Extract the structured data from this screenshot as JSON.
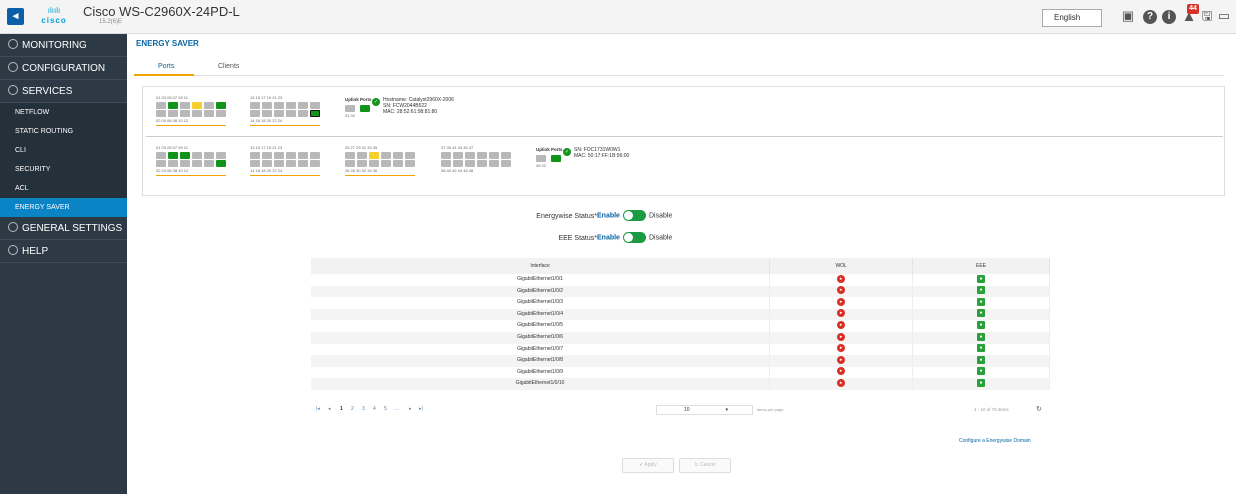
{
  "header": {
    "brand": "cisco",
    "device": "Cisco WS-C2960X-24PD-L",
    "version": "15.2(6)E",
    "language": "English",
    "alert_count": "44",
    "icons": [
      "save-config-icon",
      "help-icon",
      "info-icon",
      "alert-icon",
      "save-icon",
      "monitor-icon"
    ]
  },
  "sidebar": {
    "monitoring": "MONITORING",
    "configuration": "CONFIGURATION",
    "services": "SERVICES",
    "services_items": [
      "NETFLOW",
      "STATIC ROUTING",
      "CLI",
      "SECURITY",
      "ACL",
      "ENERGY SAVER"
    ],
    "general_settings": "GENERAL SETTINGS",
    "help": "HELP"
  },
  "page": {
    "title": "ENERGY SAVER",
    "tabs": [
      "Ports",
      "Clients"
    ]
  },
  "switch1": {
    "port_odd": "01 03 05 07 09 11",
    "port_even": "02 04 06 08 10 12",
    "port_odd2": "13 15 17 19 21 23",
    "port_even2": "14 16 18 20 22 24",
    "uplink_title": "Uplink Ports",
    "uplink_nums": "01   02",
    "hostname": "Hostname: Catalyst2960X-2006",
    "sn": "SN: FCW2044B522",
    "mac": "MAC: 28:52:61:98:81:80"
  },
  "switch2": {
    "port_odd": "01 03 05 07 09 11",
    "port_even": "02 04 06 08 10 12",
    "port_odd2": "13 15 17 19 21 23",
    "port_even2": "14 16 18 20 22 24",
    "port_odd3": "25 27 29 31 33 35",
    "port_even3": "26 28 30 32 34 36",
    "port_odd4": "37 39 41 43 45 47",
    "port_even4": "38 40 42 44 46 48",
    "uplink_title": "Uplink Ports",
    "uplink_nums": "49   02",
    "sn": "SN: FOC1731W0W1",
    "mac": "MAC: 50:17:FF:1B:96:00"
  },
  "status": {
    "energywise_label": "Energywise Status*",
    "eee_label": "EEE Status*",
    "enable": "Enable",
    "disable": "Disable"
  },
  "table": {
    "headers": [
      "Interface",
      "WOL",
      "EEE"
    ],
    "rows": [
      "GigabitEthernet1/0/1",
      "GigabitEthernet1/0/2",
      "GigabitEthernet1/0/3",
      "GigabitEthernet1/0/4",
      "GigabitEthernet1/0/5",
      "GigabitEthernet1/0/6",
      "GigabitEthernet1/0/7",
      "GigabitEthernet1/0/8",
      "GigabitEthernet1/0/9",
      "GigabitEthernet1/0/10"
    ]
  },
  "pager": {
    "first": "|◂",
    "prev": "◂",
    "pages": [
      "1",
      "2",
      "3",
      "4",
      "5",
      "..."
    ],
    "next": "▸",
    "last": "▸|",
    "items_per_page": "10",
    "items_per_page_label": "items per page",
    "range": "1 - 10 of 75 items"
  },
  "footer": {
    "configure_link": "Configure a Energywise Domain",
    "apply": "✔ Apply",
    "cancel": "↻ Cancel"
  }
}
